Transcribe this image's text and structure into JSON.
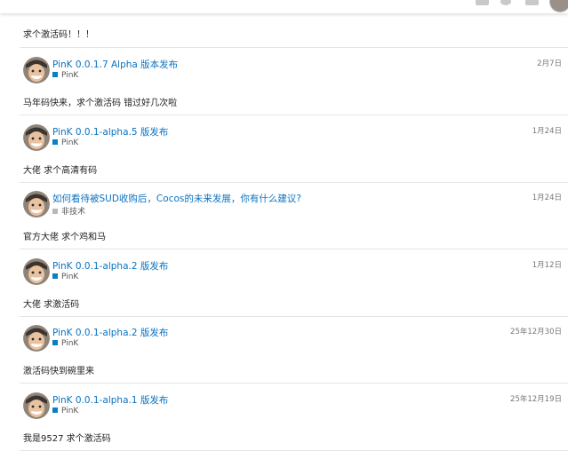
{
  "top_excerpt": "求个激活码！！！",
  "posts": [
    {
      "title": "PinK 0.0.1.7 Alpha 版本发布",
      "category": "PinK",
      "category_color": "#0b7fc6",
      "date": "2月7日",
      "excerpt": "马年码快来，求个激活码 错过好几次啦"
    },
    {
      "title": "PinK 0.0.1-alpha.5 版发布",
      "category": "PinK",
      "category_color": "#0b7fc6",
      "date": "1月24日",
      "excerpt": "大佬 求个高清有码"
    },
    {
      "title": "如何看待被SUD收购后，Cocos的未来发展，你有什么建议?",
      "category": "非技术",
      "category_color": "#b8b8b8",
      "date": "1月24日",
      "excerpt": "官方大佬 求个鸡和马"
    },
    {
      "title": "PinK 0.0.1-alpha.2 版发布",
      "category": "PinK",
      "category_color": "#0b7fc6",
      "date": "1月12日",
      "excerpt": "大佬 求激活码"
    },
    {
      "title": "PinK 0.0.1-alpha.2 版发布",
      "category": "PinK",
      "category_color": "#0b7fc6",
      "date": "25年12月30日",
      "excerpt": "激活码快到碗里来"
    },
    {
      "title": "PinK 0.0.1-alpha.1 版发布",
      "category": "PinK",
      "category_color": "#0b7fc6",
      "date": "25年12月19日",
      "excerpt": "我是9527 求个激活码"
    }
  ]
}
